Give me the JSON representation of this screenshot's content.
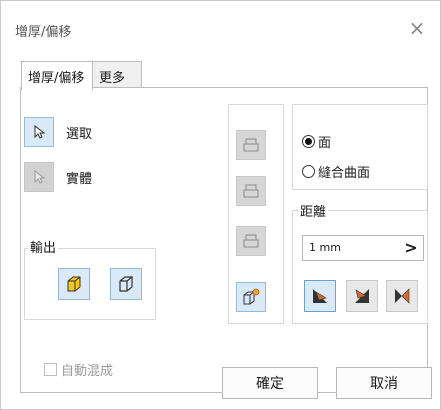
{
  "dialog": {
    "title": "增厚/偏移",
    "close_symbol": "×"
  },
  "tabs": [
    {
      "label": "增厚/偏移",
      "active": true
    },
    {
      "label": "更多",
      "active": false
    }
  ],
  "select": {
    "select_label": "選取",
    "solid_label": "實體"
  },
  "output": {
    "title": "輸出",
    "items": [
      "solid-output-icon",
      "surface-output-icon"
    ]
  },
  "mode": {
    "face_label": "面",
    "quilt_label": "縫合曲面",
    "selected": "face"
  },
  "distance": {
    "title": "距離",
    "value": "1 mm",
    "arrow": ">"
  },
  "direction": {
    "active_index": 0
  },
  "footer": {
    "auto_blend_label": "自動混成",
    "ok_label": "確定",
    "cancel_label": "取消"
  },
  "colors": {
    "accent_bg": "#d9e9f7",
    "accent_border": "#9ab9d8",
    "box_yellow": "#f5c518",
    "direction_orange": "#d46a2a"
  }
}
